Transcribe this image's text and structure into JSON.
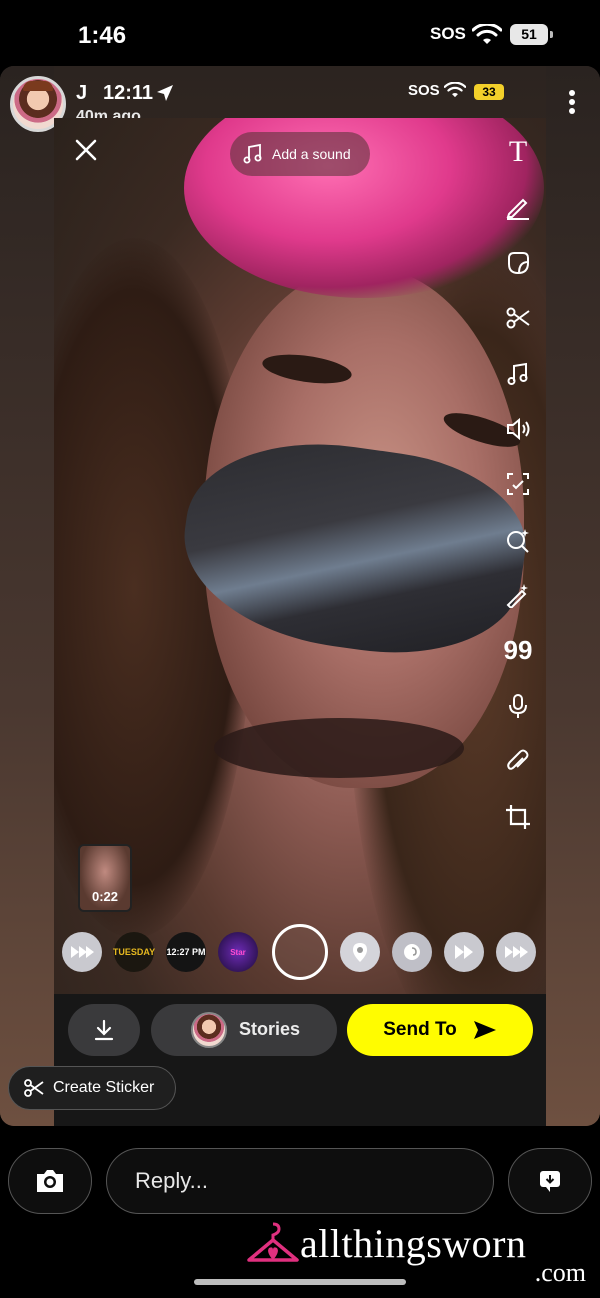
{
  "status_bar": {
    "time": "1:46",
    "sos": "SOS",
    "battery": "51"
  },
  "story": {
    "user": "J",
    "time": "12:11",
    "ago": "40m ago",
    "inner_status": {
      "sos": "SOS",
      "battery": "33"
    }
  },
  "editor": {
    "add_sound": "Add a sound",
    "tools": [
      "text-tool",
      "pen-tool",
      "sticker-tool",
      "scissors-tool",
      "music-tool",
      "sound-tool",
      "smart-crop-tool",
      "ai-lens-tool",
      "magic-tool",
      "quote-tool",
      "mic-tool",
      "link-tool",
      "crop-tool"
    ],
    "tool_text": {
      "text": "T",
      "quote": "99"
    },
    "clip_duration": "0:22",
    "lenses": {
      "tuesday": "TUESDAY",
      "time": "12:27 PM",
      "galaxy": "Star"
    }
  },
  "actions": {
    "stories_label": "Stories",
    "send_label": "Send To",
    "create_sticker": "Create Sticker"
  },
  "reply": {
    "placeholder": "Reply..."
  },
  "watermark": {
    "name": "allthingsworn",
    "tld": ".com"
  },
  "colors": {
    "send_yellow": "#fffc00",
    "hanger_pink": "#e0307f",
    "battery_yellow": "#f3d02a"
  }
}
